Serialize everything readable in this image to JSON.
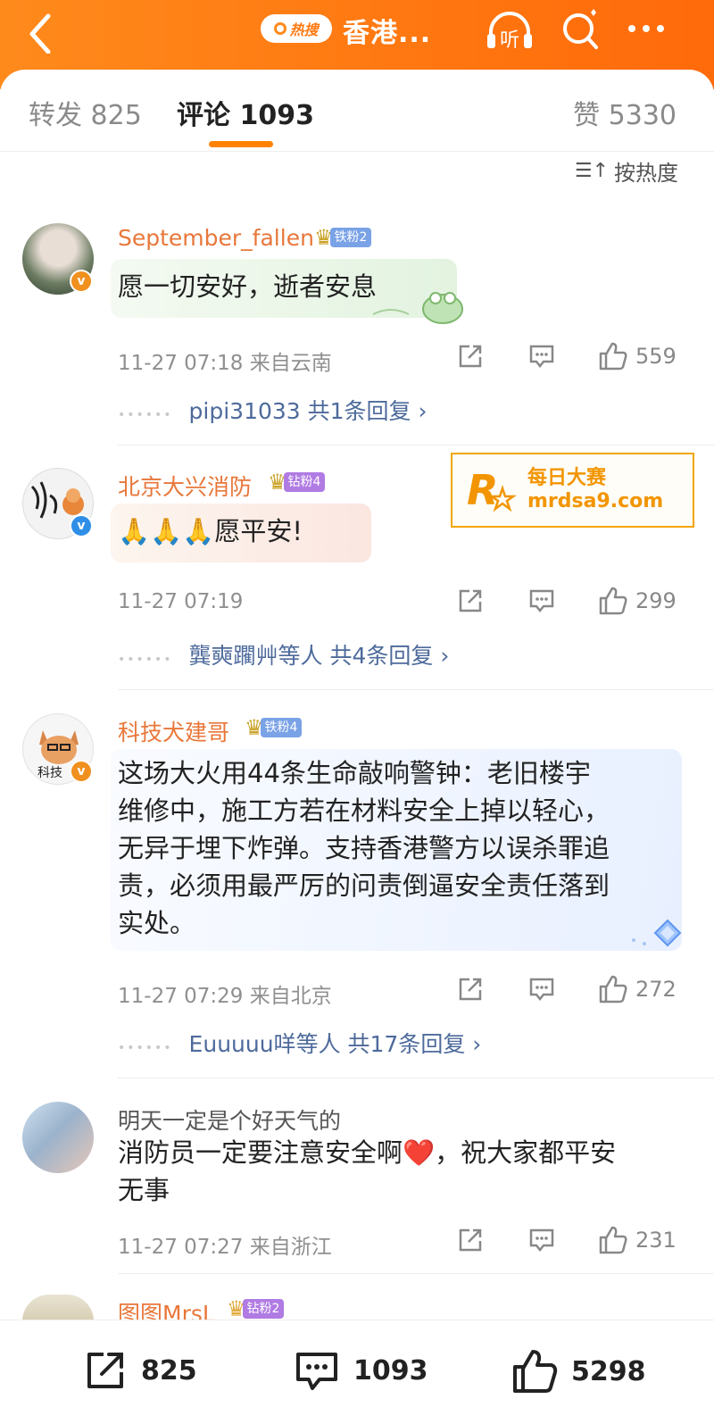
{
  "header": {
    "hot_search_label": "热搜",
    "topic_title": "香港...",
    "listen_label": "听"
  },
  "tabs": {
    "repost": "转发 825",
    "comments": "评论 1093",
    "likes": "赞 5330"
  },
  "sort": {
    "label": "按热度"
  },
  "watermark": {
    "name": "每日大赛",
    "url": "mrdsa9.com",
    "url_prefix": "mrdsa9.com"
  },
  "comments": [
    {
      "username": "September_fallen",
      "fan_badge": "铁粉2",
      "text": "愿一切安好，逝者安息",
      "time_location": "11-27 07:18 来自云南",
      "likes": "559",
      "replies": "pipi31033  共1条回复 ›"
    },
    {
      "username": "北京大兴消防",
      "fan_badge": "钻粉4",
      "text": "🙏🙏🙏愿平安!",
      "time_location": "11-27 07:19",
      "likes": "299",
      "replies": "龔奭躙艸等人  共4条回复 ›"
    },
    {
      "username": "科技犬建哥",
      "fan_badge": "铁粉4",
      "text_lines": [
        "这场大火用44条生命敲响警钟：老旧楼宇",
        "维修中，施工方若在材料安全上掉以轻心，",
        "无异于埋下炸弹。支持香港警方以误杀罪追",
        "责，必须用最严厉的问责倒逼安全责任落到",
        "实处。"
      ],
      "time_location": "11-27 07:29 来自北京",
      "likes": "272",
      "replies": "Euuuuu咩等人  共17条回复 ›"
    },
    {
      "username": "明天一定是个好天气的",
      "text_line1": "消防员一定要注意安全啊❤️，祝大家都平安",
      "text_line2": "无事",
      "time_location": "11-27 07:27 来自浙江",
      "likes": "231"
    },
    {
      "username": "图图MrsL",
      "fan_badge": "钻粉2"
    }
  ],
  "bottom_bar": {
    "repost_count": "825",
    "comment_count": "1093",
    "like_count": "5298"
  },
  "colors": {
    "brand_orange": "#ff8200",
    "username_orange": "#e8773a",
    "reply_link_blue": "#4d6a9b",
    "verified_badge": "#f0901e"
  }
}
